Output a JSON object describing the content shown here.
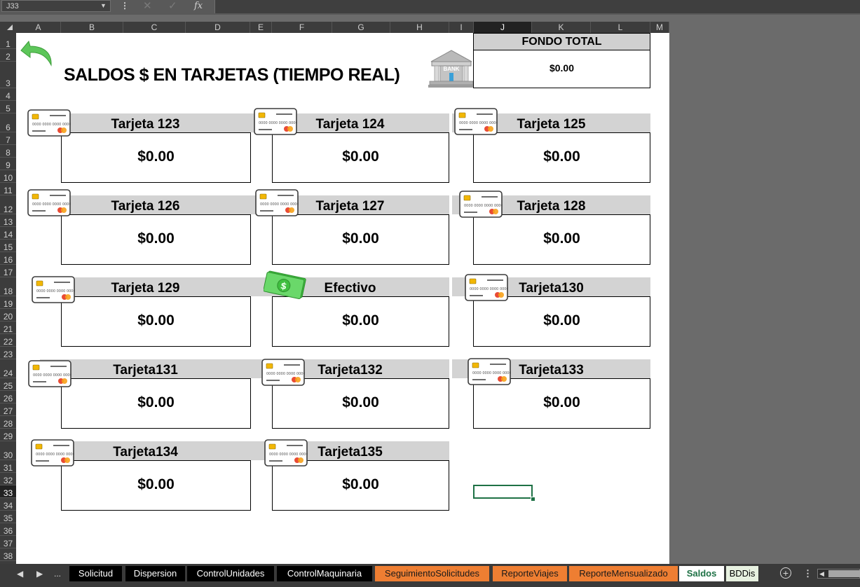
{
  "formula_bar": {
    "name_box": "J33",
    "more": "⋮",
    "cancel": "✕",
    "enter": "✓",
    "fx": "fx",
    "formula": ""
  },
  "columns": [
    "A",
    "B",
    "C",
    "D",
    "E",
    "F",
    "G",
    "H",
    "I",
    "J",
    "K",
    "L",
    "M"
  ],
  "selected_column": "J",
  "rows": [
    "1",
    "2",
    "3",
    "4",
    "5",
    "6",
    "7",
    "8",
    "9",
    "10",
    "11",
    "12",
    "13",
    "14",
    "15",
    "16",
    "17",
    "18",
    "19",
    "20",
    "21",
    "22",
    "23",
    "24",
    "25",
    "26",
    "27",
    "28",
    "29",
    "30",
    "31",
    "32",
    "33",
    "34",
    "35",
    "36",
    "37",
    "38"
  ],
  "selected_row": "33",
  "sheet": {
    "title": "SALDOS $ EN TARJETAS (TIEMPO REAL)",
    "back_icon": "green-undo-arrow-icon",
    "bank": {
      "icon": "bank-building-icon",
      "icon_text": "BANK",
      "label": "FONDO TOTAL",
      "value": "$0.00"
    },
    "cards": [
      {
        "label": "Tarjeta 123",
        "value": "$0.00",
        "icon": "credit-card-icon"
      },
      {
        "label": "Tarjeta 124",
        "value": "$0.00",
        "icon": "credit-card-icon"
      },
      {
        "label": "Tarjeta 125",
        "value": "$0.00",
        "icon": "credit-card-icon"
      },
      {
        "label": "Tarjeta 126",
        "value": "$0.00",
        "icon": "credit-card-icon"
      },
      {
        "label": "Tarjeta 127",
        "value": "$0.00",
        "icon": "credit-card-icon"
      },
      {
        "label": "Tarjeta 128",
        "value": "$0.00",
        "icon": "credit-card-icon"
      },
      {
        "label": "Tarjeta 129",
        "value": "$0.00",
        "icon": "credit-card-icon"
      },
      {
        "label": "Efectivo",
        "value": "$0.00",
        "icon": "cash-bill-icon"
      },
      {
        "label": "Tarjeta130",
        "value": "$0.00",
        "icon": "credit-card-icon"
      },
      {
        "label": "Tarjeta131",
        "value": "$0.00",
        "icon": "credit-card-icon"
      },
      {
        "label": "Tarjeta132",
        "value": "$0.00",
        "icon": "credit-card-icon"
      },
      {
        "label": "Tarjeta133",
        "value": "$0.00",
        "icon": "credit-card-icon"
      },
      {
        "label": "Tarjeta134",
        "value": "$0.00",
        "icon": "credit-card-icon"
      },
      {
        "label": "Tarjeta135",
        "value": "$0.00",
        "icon": "credit-card-icon"
      }
    ]
  },
  "tabs": {
    "nav": [
      "◀",
      "▶",
      "..."
    ],
    "items": [
      {
        "label": "Solicitud",
        "style": "dark"
      },
      {
        "label": "Dispersion",
        "style": "dark"
      },
      {
        "label": "ControlUnidades",
        "style": "dark"
      },
      {
        "label": "ControlMaquinaria",
        "style": "dark"
      },
      {
        "label": "SeguimientoSolicitudes",
        "style": "orange"
      },
      {
        "label": "ReporteViajes",
        "style": "orange"
      },
      {
        "label": "ReporteMensualizado",
        "style": "orange"
      },
      {
        "label": "Saldos",
        "style": "active"
      },
      {
        "label": "BDDis",
        "style": "light"
      }
    ],
    "add": "+",
    "more": "⋮"
  },
  "colors": {
    "accent_green": "#1e7145",
    "card_header": "#d3d3d3",
    "orange_tab": "#ee7e32"
  }
}
